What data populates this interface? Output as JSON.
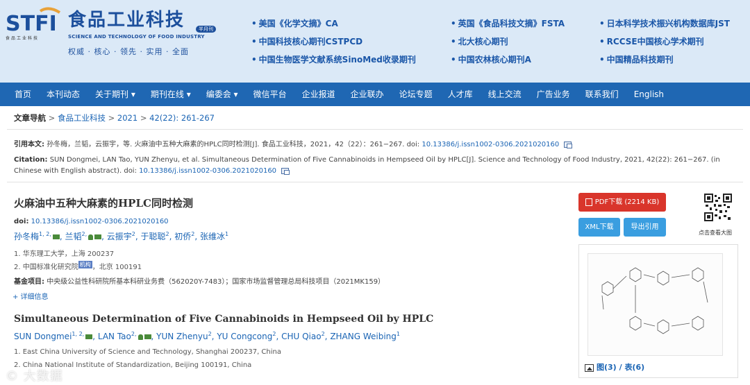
{
  "header": {
    "logo_mark": "STFI",
    "logo_sub": "食品工业科技",
    "logo_cn": "食品工业科技",
    "logo_en": "SCIENCE AND TECHNOLOGY OF FOOD INDUSTRY",
    "logo_badge": "半月刊",
    "slogan": "权威 · 核心 · 领先 · 实用 · 全面",
    "indexes": [
      "美国《化学文摘》CA",
      "中国科技核心期刊CSTPCD",
      "中国生物医学文献系统SinoMed收录期刊",
      "英国《食品科技文摘》FSTA",
      "北大核心期刊",
      "中国农林核心期刊A",
      "日本科学技术振兴机构数据库JST",
      "RCCSE中国核心学术期刊",
      "中国精品科技期刊"
    ]
  },
  "nav": {
    "items": [
      "首页",
      "本刊动态",
      "关于期刊 ▾",
      "期刊在线 ▾",
      "编委会 ▾",
      "微信平台",
      "企业报道",
      "企业联办",
      "论坛专题",
      "人才库",
      "线上交流",
      "广告业务",
      "联系我们",
      "English"
    ]
  },
  "breadcrumb": {
    "label": "文章导航",
    "sep": ">",
    "journal": "食品工业科技",
    "year": "2021",
    "issue": "42(22): 261-267"
  },
  "citation": {
    "cn_label": "引用本文:",
    "cn_text": "孙冬梅，兰韬，云振宇，等. 火麻油中五种大麻素的HPLC同时检测[J]. 食品工业科技，2021，42（22）：261−267. doi:",
    "cn_doi": "10.13386/j.issn1002-0306.2021020160",
    "en_label": "Citation:",
    "en_text": "SUN Dongmei, LAN Tao, YUN Zhenyu, et al. Simultaneous Determination of Five Cannabinoids in Hempseed Oil by HPLC[J]. Science and Technology of Food Industry, 2021, 42(22): 261−267. (in Chinese with English abstract).",
    "en_doi_prefix": "doi:",
    "en_doi": "10.13386/j.issn1002-0306.2021020160"
  },
  "article": {
    "title_cn": "火麻油中五种大麻素的HPLC同时检测",
    "doi_label": "doi:",
    "doi": "10.13386/j.issn1002-0306.2021020160",
    "authors_cn": [
      {
        "name": "孙冬梅",
        "sup": "1, 2,"
      },
      {
        "name": "兰韬",
        "sup": "2,"
      },
      {
        "name": "云振宇",
        "sup": "2"
      },
      {
        "name": "于聪聪",
        "sup": "2"
      },
      {
        "name": "初侨",
        "sup": "2"
      },
      {
        "name": "张维冰",
        "sup": "1"
      }
    ],
    "affiliations_cn": [
      "1.  华东理工大学，上海 200237",
      "2.  中国标准化研究院",
      "，北京 100191"
    ],
    "inst_badge": "机构",
    "fund_label": "基金项目:",
    "fund_text": "中央级公益性科研院所基本科研业务费（562020Y-7483）；国家市场监督管理总局科技项目（2021MK159）",
    "more_link": "+ 详细信息",
    "title_en": "Simultaneous Determination of Five Cannabinoids in Hempseed Oil by HPLC",
    "authors_en": [
      {
        "name": "SUN Dongmei",
        "sup": "1, 2,"
      },
      {
        "name": "LAN Tao",
        "sup": "2,"
      },
      {
        "name": "YUN Zhenyu",
        "sup": "2"
      },
      {
        "name": "YU Congcong",
        "sup": "2"
      },
      {
        "name": "CHU Qiao",
        "sup": "2"
      },
      {
        "name": "ZHANG Weibing",
        "sup": "1"
      }
    ],
    "affiliations_en": [
      "1.  East China University of Science and Technology, Shanghai 200237, China",
      "2.  China National Institute of Standardization, Beijing 100191, China"
    ]
  },
  "sidebar": {
    "pdf_label": "PDF下载 (2214 KB)",
    "xml_label": "XML下载",
    "export_label": "导出引用",
    "qr_label": "点击查看大图",
    "figures_label": "图(3)",
    "tables_label": "表(6)",
    "fig_sep": "/"
  },
  "watermark": "© 大数据",
  "colors": {
    "header_bg": "#dbe9f7",
    "nav_bg": "#1f67b3",
    "link": "#1a64b4",
    "pdf_button": "#d9352b",
    "action_button": "#3a9ee0"
  }
}
